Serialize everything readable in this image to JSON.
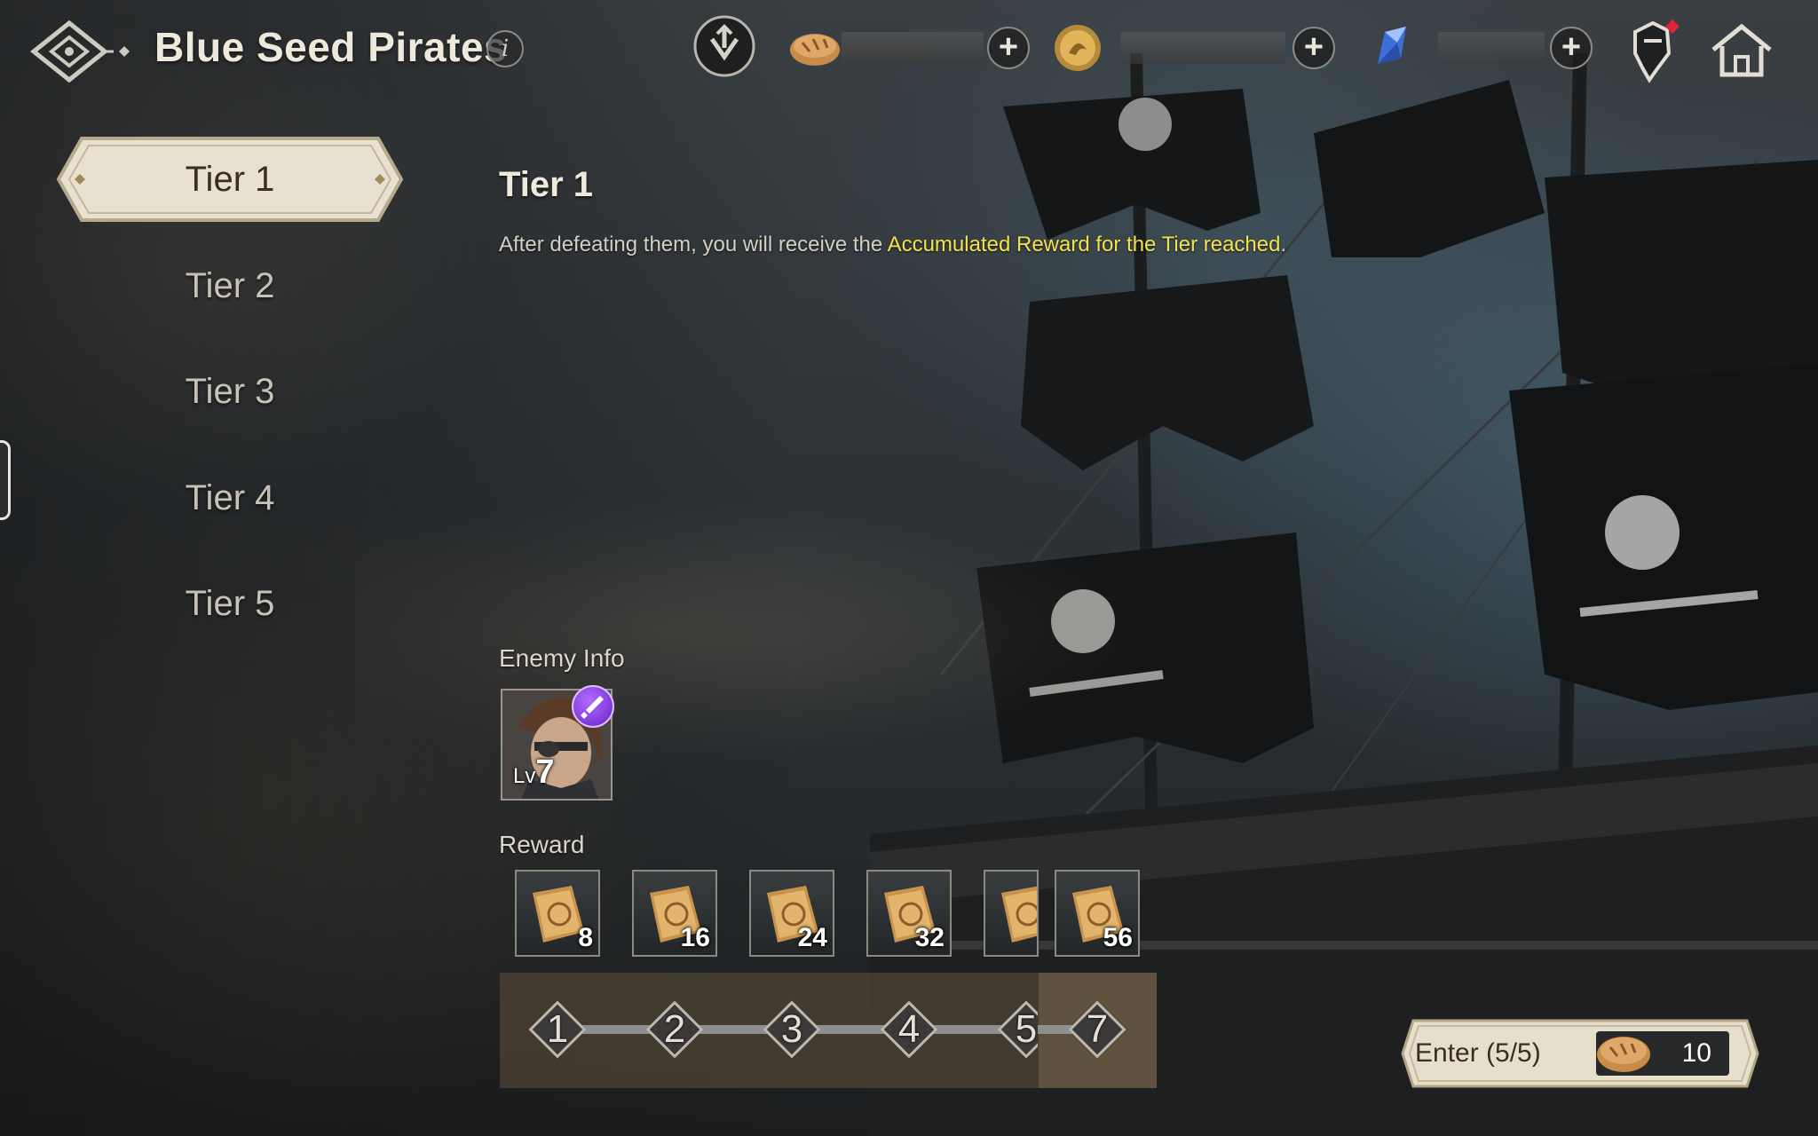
{
  "header": {
    "title": "Blue Seed Pirates",
    "info_glyph": "i",
    "resources": [
      {
        "name": "bread-icon",
        "plus": "+"
      },
      {
        "name": "gold-coin-icon",
        "plus": "+"
      },
      {
        "name": "blue-crystal-icon",
        "plus": "+"
      }
    ]
  },
  "sidebar": {
    "tiers": [
      {
        "label": "Tier 1",
        "active": true
      },
      {
        "label": "Tier 2",
        "active": false
      },
      {
        "label": "Tier 3",
        "active": false
      },
      {
        "label": "Tier 4",
        "active": false
      },
      {
        "label": "Tier 5",
        "active": false
      }
    ]
  },
  "main": {
    "tier_title": "Tier 1",
    "desc_prefix": "After defeating them, you will receive the ",
    "desc_highlight": "Accumulated Reward for the Tier reached",
    "desc_suffix": ".",
    "enemy_label": "Enemy Info",
    "enemy": {
      "lv_prefix": "Lv",
      "level": "7"
    },
    "reward_label": "Reward",
    "rewards": [
      "8",
      "16",
      "24",
      "32",
      "",
      "56"
    ],
    "nodes": [
      "1",
      "2",
      "3",
      "4",
      "5",
      "7"
    ]
  },
  "enter": {
    "label": "Enter (5/5)",
    "cost": "10"
  },
  "colors": {
    "highlight": "#f2e24a",
    "active_tier_text": "#3b2e20",
    "enemy_badge": "#8a3cf0"
  }
}
